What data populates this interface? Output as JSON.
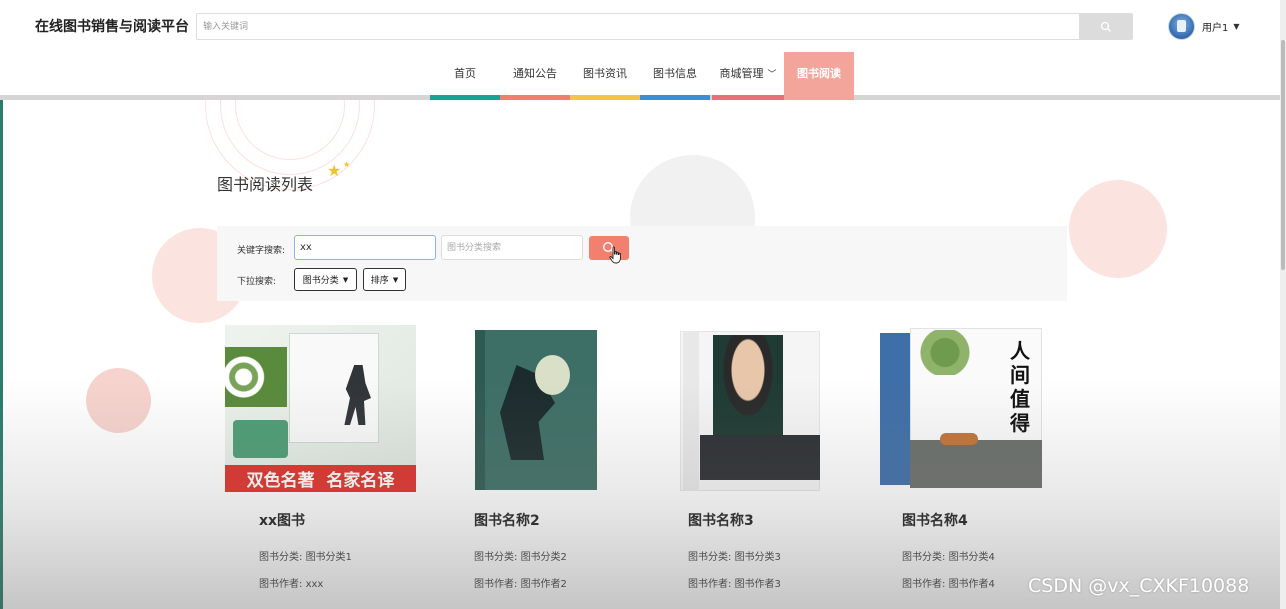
{
  "header": {
    "brand": "在线图书销售与阅读平台",
    "search_placeholder": "输入关键词",
    "user_name": "用户1"
  },
  "nav": {
    "items": [
      {
        "label": "首页",
        "color": "#1aa394"
      },
      {
        "label": "通知公告",
        "color": "#f0806e"
      },
      {
        "label": "图书资讯",
        "color": "#f5c24e"
      },
      {
        "label": "图书信息",
        "color": "#3b8fd6"
      },
      {
        "label": "商城管理",
        "color": "#e86e78",
        "has_dropdown": true
      },
      {
        "label": "图书阅读",
        "color": "#f3a59b",
        "active": true
      }
    ]
  },
  "page": {
    "title": "图书阅读列表"
  },
  "search_panel": {
    "keyword_label": "关键字搜索:",
    "keyword_value": "xx",
    "category_placeholder": "图书分类搜索",
    "dropdown_label": "下拉搜索:",
    "category_dropdown": "图书分类",
    "sort_dropdown": "排序"
  },
  "books": [
    {
      "title": "xx图书",
      "category_label": "图书分类:",
      "category": "图书分类1",
      "author_label": "图书作者:",
      "author": "xxx",
      "cover_banner": "双色名著  名家名译"
    },
    {
      "title": "图书名称2",
      "category_label": "图书分类:",
      "category": "图书分类2",
      "author_label": "图书作者:",
      "author": "图书作者2"
    },
    {
      "title": "图书名称3",
      "category_label": "图书分类:",
      "category": "图书分类3",
      "author_label": "图书作者:",
      "author": "图书作者3"
    },
    {
      "title": "图书名称4",
      "category_label": "图书分类:",
      "category": "图书分类4",
      "author_label": "图书作者:",
      "author": "图书作者4",
      "cover_text": "人间值得"
    }
  ],
  "watermark": "CSDN @vx_CXKF10088"
}
